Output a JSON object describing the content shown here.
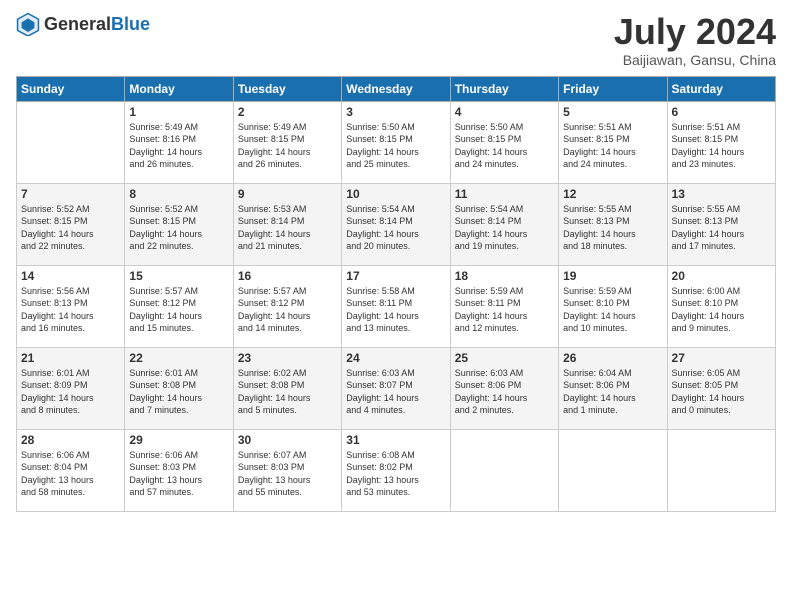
{
  "header": {
    "logo_general": "General",
    "logo_blue": "Blue",
    "month_title": "July 2024",
    "subtitle": "Baijiawan, Gansu, China"
  },
  "days_of_week": [
    "Sunday",
    "Monday",
    "Tuesday",
    "Wednesday",
    "Thursday",
    "Friday",
    "Saturday"
  ],
  "weeks": [
    [
      {
        "day": "",
        "info": ""
      },
      {
        "day": "1",
        "info": "Sunrise: 5:49 AM\nSunset: 8:16 PM\nDaylight: 14 hours\nand 26 minutes."
      },
      {
        "day": "2",
        "info": "Sunrise: 5:49 AM\nSunset: 8:15 PM\nDaylight: 14 hours\nand 26 minutes."
      },
      {
        "day": "3",
        "info": "Sunrise: 5:50 AM\nSunset: 8:15 PM\nDaylight: 14 hours\nand 25 minutes."
      },
      {
        "day": "4",
        "info": "Sunrise: 5:50 AM\nSunset: 8:15 PM\nDaylight: 14 hours\nand 24 minutes."
      },
      {
        "day": "5",
        "info": "Sunrise: 5:51 AM\nSunset: 8:15 PM\nDaylight: 14 hours\nand 24 minutes."
      },
      {
        "day": "6",
        "info": "Sunrise: 5:51 AM\nSunset: 8:15 PM\nDaylight: 14 hours\nand 23 minutes."
      }
    ],
    [
      {
        "day": "7",
        "info": "Sunrise: 5:52 AM\nSunset: 8:15 PM\nDaylight: 14 hours\nand 22 minutes."
      },
      {
        "day": "8",
        "info": "Sunrise: 5:52 AM\nSunset: 8:15 PM\nDaylight: 14 hours\nand 22 minutes."
      },
      {
        "day": "9",
        "info": "Sunrise: 5:53 AM\nSunset: 8:14 PM\nDaylight: 14 hours\nand 21 minutes."
      },
      {
        "day": "10",
        "info": "Sunrise: 5:54 AM\nSunset: 8:14 PM\nDaylight: 14 hours\nand 20 minutes."
      },
      {
        "day": "11",
        "info": "Sunrise: 5:54 AM\nSunset: 8:14 PM\nDaylight: 14 hours\nand 19 minutes."
      },
      {
        "day": "12",
        "info": "Sunrise: 5:55 AM\nSunset: 8:13 PM\nDaylight: 14 hours\nand 18 minutes."
      },
      {
        "day": "13",
        "info": "Sunrise: 5:55 AM\nSunset: 8:13 PM\nDaylight: 14 hours\nand 17 minutes."
      }
    ],
    [
      {
        "day": "14",
        "info": "Sunrise: 5:56 AM\nSunset: 8:13 PM\nDaylight: 14 hours\nand 16 minutes."
      },
      {
        "day": "15",
        "info": "Sunrise: 5:57 AM\nSunset: 8:12 PM\nDaylight: 14 hours\nand 15 minutes."
      },
      {
        "day": "16",
        "info": "Sunrise: 5:57 AM\nSunset: 8:12 PM\nDaylight: 14 hours\nand 14 minutes."
      },
      {
        "day": "17",
        "info": "Sunrise: 5:58 AM\nSunset: 8:11 PM\nDaylight: 14 hours\nand 13 minutes."
      },
      {
        "day": "18",
        "info": "Sunrise: 5:59 AM\nSunset: 8:11 PM\nDaylight: 14 hours\nand 12 minutes."
      },
      {
        "day": "19",
        "info": "Sunrise: 5:59 AM\nSunset: 8:10 PM\nDaylight: 14 hours\nand 10 minutes."
      },
      {
        "day": "20",
        "info": "Sunrise: 6:00 AM\nSunset: 8:10 PM\nDaylight: 14 hours\nand 9 minutes."
      }
    ],
    [
      {
        "day": "21",
        "info": "Sunrise: 6:01 AM\nSunset: 8:09 PM\nDaylight: 14 hours\nand 8 minutes."
      },
      {
        "day": "22",
        "info": "Sunrise: 6:01 AM\nSunset: 8:08 PM\nDaylight: 14 hours\nand 7 minutes."
      },
      {
        "day": "23",
        "info": "Sunrise: 6:02 AM\nSunset: 8:08 PM\nDaylight: 14 hours\nand 5 minutes."
      },
      {
        "day": "24",
        "info": "Sunrise: 6:03 AM\nSunset: 8:07 PM\nDaylight: 14 hours\nand 4 minutes."
      },
      {
        "day": "25",
        "info": "Sunrise: 6:03 AM\nSunset: 8:06 PM\nDaylight: 14 hours\nand 2 minutes."
      },
      {
        "day": "26",
        "info": "Sunrise: 6:04 AM\nSunset: 8:06 PM\nDaylight: 14 hours\nand 1 minute."
      },
      {
        "day": "27",
        "info": "Sunrise: 6:05 AM\nSunset: 8:05 PM\nDaylight: 14 hours\nand 0 minutes."
      }
    ],
    [
      {
        "day": "28",
        "info": "Sunrise: 6:06 AM\nSunset: 8:04 PM\nDaylight: 13 hours\nand 58 minutes."
      },
      {
        "day": "29",
        "info": "Sunrise: 6:06 AM\nSunset: 8:03 PM\nDaylight: 13 hours\nand 57 minutes."
      },
      {
        "day": "30",
        "info": "Sunrise: 6:07 AM\nSunset: 8:03 PM\nDaylight: 13 hours\nand 55 minutes."
      },
      {
        "day": "31",
        "info": "Sunrise: 6:08 AM\nSunset: 8:02 PM\nDaylight: 13 hours\nand 53 minutes."
      },
      {
        "day": "",
        "info": ""
      },
      {
        "day": "",
        "info": ""
      },
      {
        "day": "",
        "info": ""
      }
    ]
  ]
}
